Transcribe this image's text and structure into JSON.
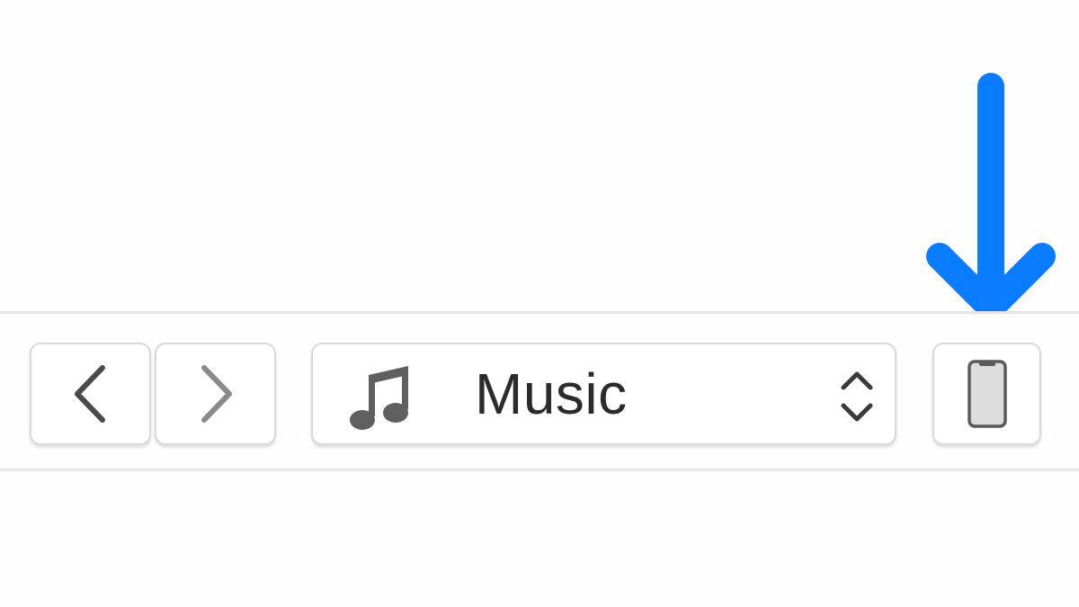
{
  "toolbar": {
    "back_icon": "chevron-left-icon",
    "forward_icon": "chevron-right-icon",
    "media_selector": {
      "icon": "music-note-icon",
      "label": "Music",
      "dropdown_icon": "up-down-chevron-icon"
    },
    "device_icon": "iphone-icon"
  },
  "annotation": {
    "icon": "down-arrow-icon",
    "color": "#0a7cff"
  }
}
